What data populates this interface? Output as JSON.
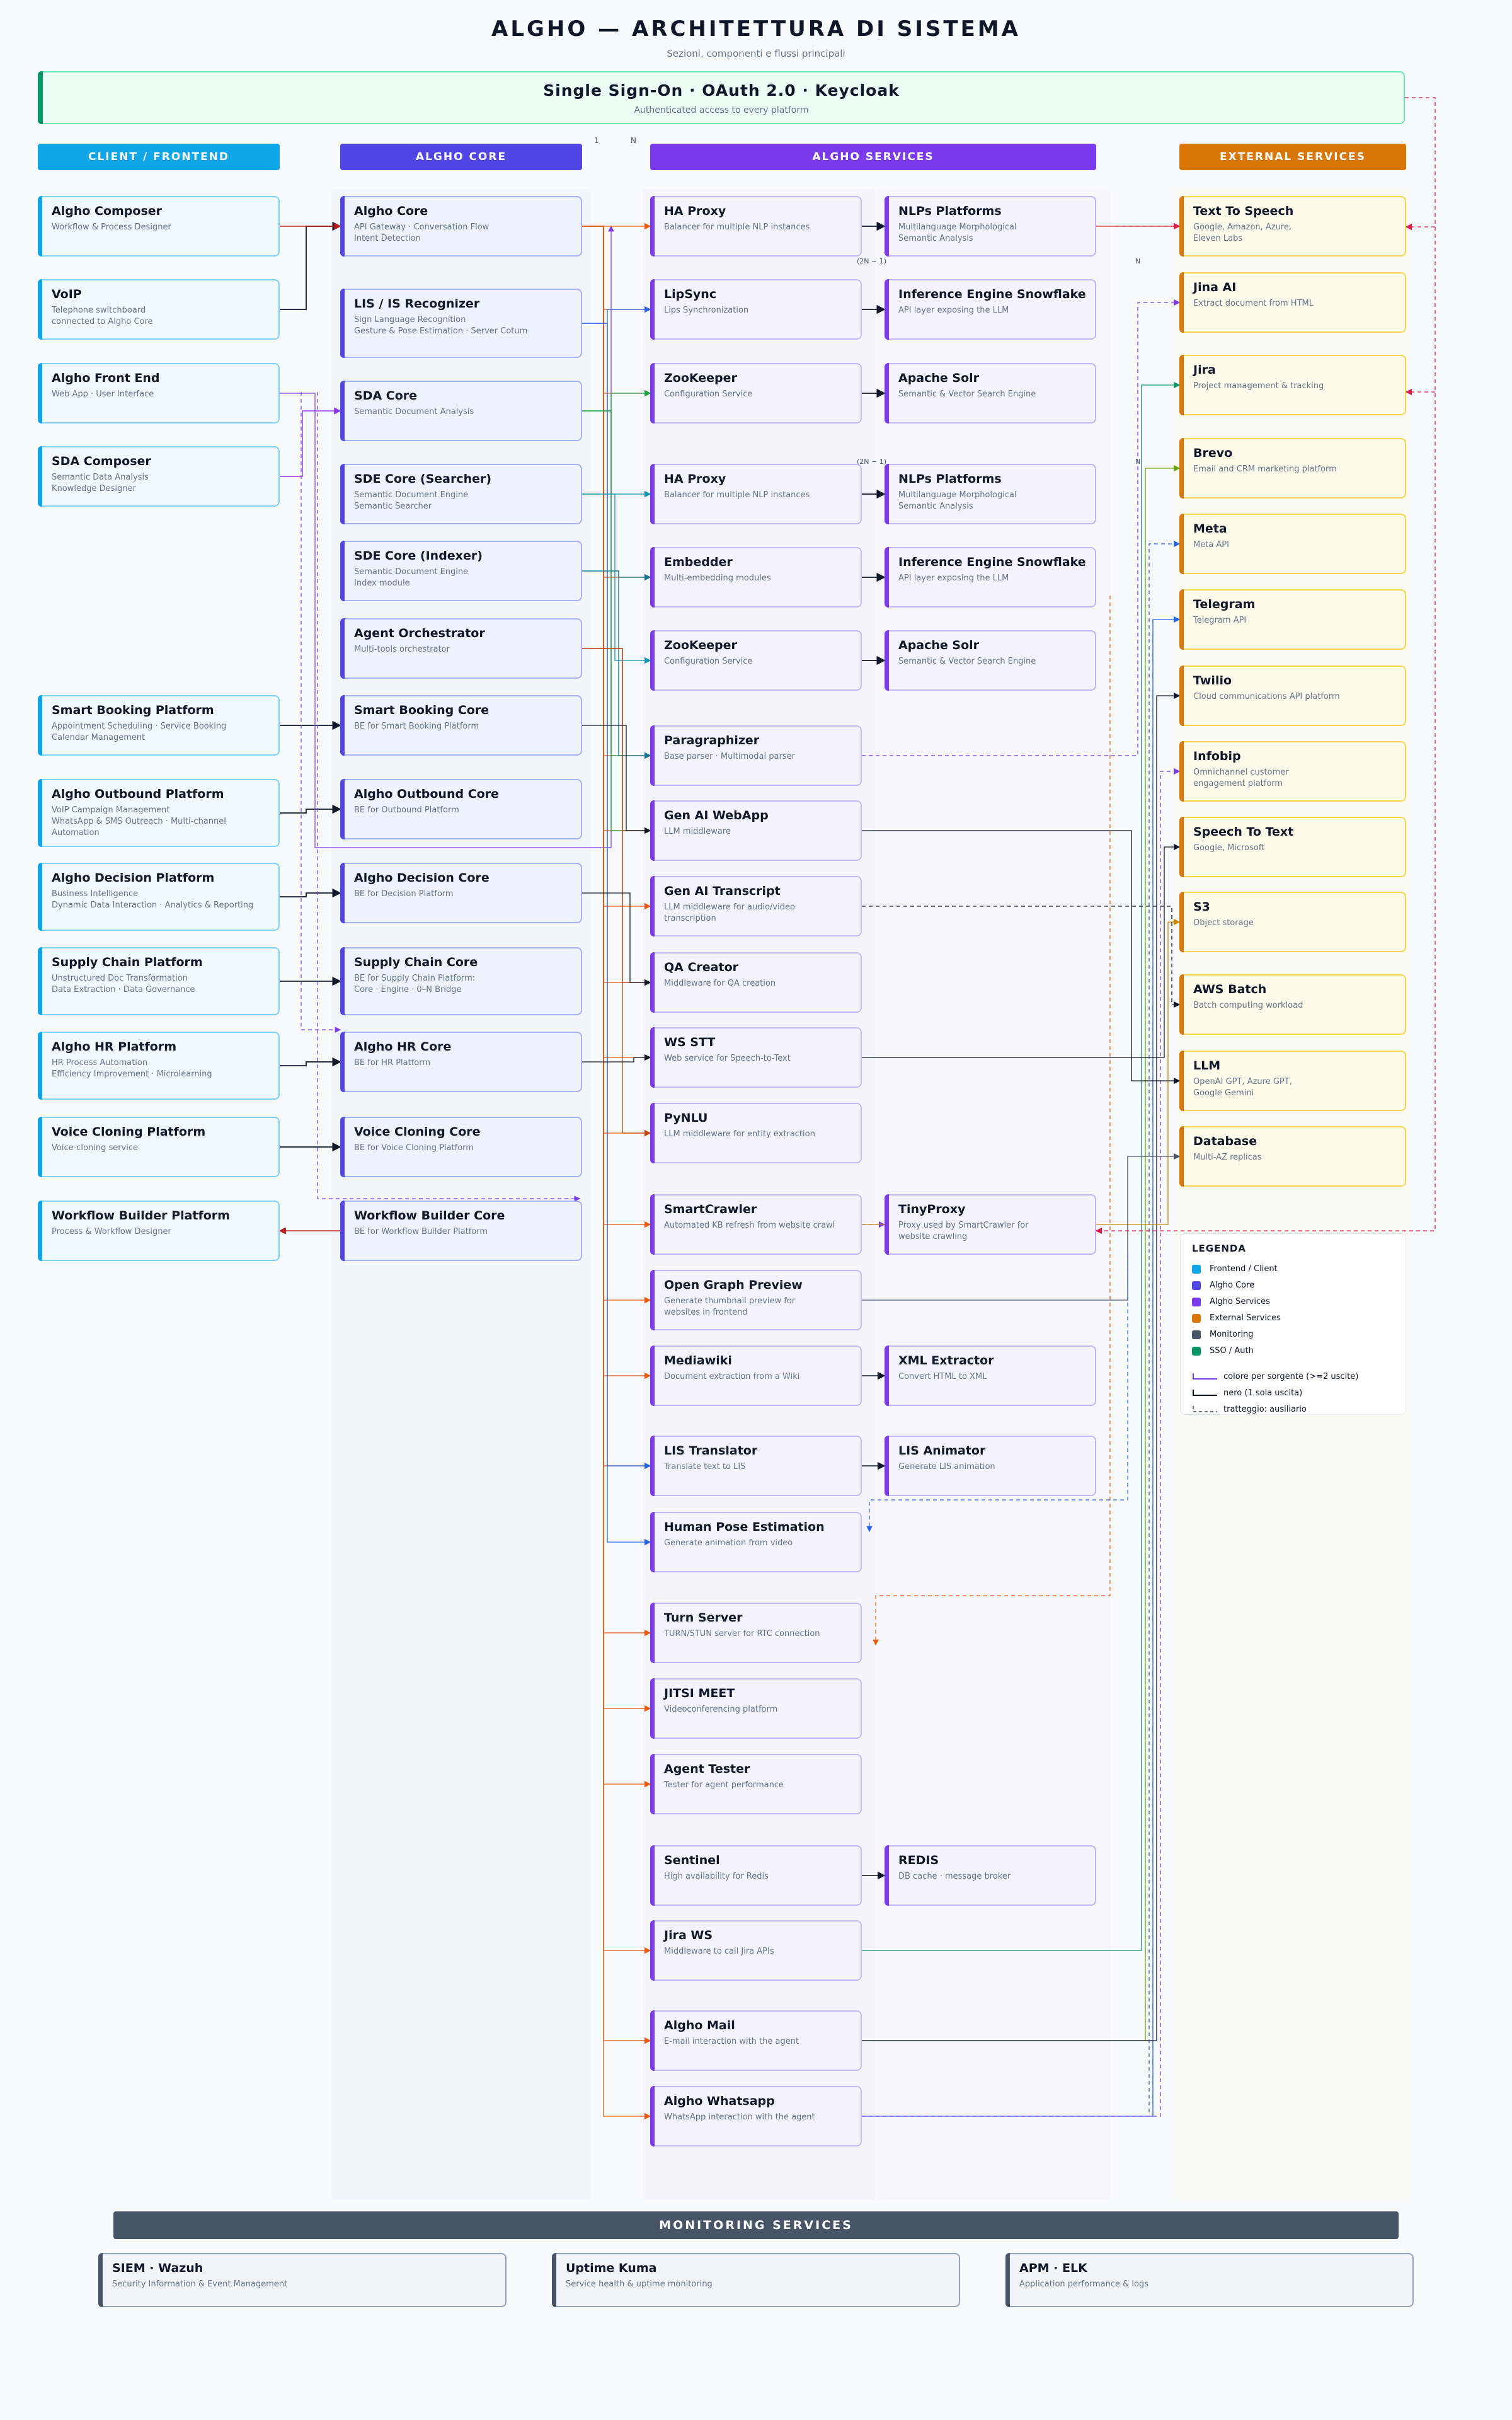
{
  "header": {
    "title": "ALGHO — ARCHITETTURA DI SISTEMA",
    "subtitle": "Sezioni, componenti e flussi principali"
  },
  "sso": {
    "title": "Single Sign-On · OAuth 2.0 · Keycloak",
    "subtitle": "Authenticated access to every platform"
  },
  "columns": {
    "client": "CLIENT / FRONTEND",
    "core": "ALGHO CORE",
    "services": "ALGHO SERVICES",
    "external": "EXTERNAL SERVICES"
  },
  "ratio_label": {
    "one": "1",
    "n": "N"
  },
  "replica_labels": [
    "(2N − 1)",
    "N",
    "(2N − 1)",
    "N"
  ],
  "colors": {
    "client": "#0ea5e9",
    "core": "#4f46e5",
    "services": "#7c3aed",
    "external": "#d97706",
    "monitoring": "#475569",
    "sso": "#059669"
  },
  "client_nodes": [
    {
      "title": "Algho Composer",
      "sub": "Workflow & Process Designer"
    },
    {
      "title": "VoIP",
      "sub": "Telephone switchboard\nconnected to Algho Core"
    },
    {
      "title": "Algho Front End",
      "sub": "Web App · User Interface"
    },
    {
      "title": "SDA Composer",
      "sub": "Semantic Data Analysis\nKnowledge Designer"
    },
    {
      "title": "Smart Booking Platform",
      "sub": "Appointment Scheduling · Service Booking\nCalendar Management"
    },
    {
      "title": "Algho Outbound Platform",
      "sub": "VoIP Campaign Management\nWhatsApp & SMS Outreach · Multi-channel Automation"
    },
    {
      "title": "Algho Decision Platform",
      "sub": "Business Intelligence\nDynamic Data Interaction · Analytics & Reporting"
    },
    {
      "title": "Supply Chain Platform",
      "sub": "Unstructured Doc Transformation\nData Extraction · Data Governance"
    },
    {
      "title": "Algho HR Platform",
      "sub": "HR Process Automation\nEfficiency Improvement · Microlearning"
    },
    {
      "title": "Voice Cloning Platform",
      "sub": "Voice-cloning service"
    },
    {
      "title": "Workflow Builder Platform",
      "sub": "Process & Workflow Designer"
    }
  ],
  "core_nodes": [
    {
      "title": "Algho Core",
      "sub": "API Gateway · Conversation Flow\nIntent Detection"
    },
    {
      "title": "LIS / IS Recognizer",
      "sub": "Sign Language Recognition\nGesture & Pose Estimation · Server Cotum"
    },
    {
      "title": "SDA Core",
      "sub": "Semantic Document Analysis"
    },
    {
      "title": "SDE Core (Searcher)",
      "sub": "Semantic Document Engine\nSemantic Searcher"
    },
    {
      "title": "SDE Core (Indexer)",
      "sub": "Semantic Document Engine\nIndex module"
    },
    {
      "title": "Agent Orchestrator",
      "sub": "Multi-tools orchestrator"
    },
    {
      "title": "Smart Booking Core",
      "sub": "BE for Smart Booking Platform"
    },
    {
      "title": "Algho Outbound Core",
      "sub": "BE for Outbound Platform"
    },
    {
      "title": "Algho Decision Core",
      "sub": "BE for Decision Platform"
    },
    {
      "title": "Supply Chain Core",
      "sub": "BE for Supply Chain Platform:\nCore · Engine · 0–N Bridge"
    },
    {
      "title": "Algho HR Core",
      "sub": "BE for HR Platform"
    },
    {
      "title": "Voice Cloning Core",
      "sub": "BE for Voice Cloning Platform"
    },
    {
      "title": "Workflow Builder Core",
      "sub": "BE for Workflow Builder Platform"
    }
  ],
  "service_nodes": [
    {
      "title": "HA Proxy",
      "sub": "Balancer for multiple NLP instances"
    },
    {
      "title": "LipSync",
      "sub": "Lips Synchronization"
    },
    {
      "title": "ZooKeeper",
      "sub": "Configuration Service"
    },
    {
      "title": "HA Proxy",
      "sub": "Balancer for multiple NLP instances"
    },
    {
      "title": "Embedder",
      "sub": "Multi-embedding modules"
    },
    {
      "title": "ZooKeeper",
      "sub": "Configuration Service"
    },
    {
      "title": "Paragraphizer",
      "sub": "Base parser · Multimodal parser"
    },
    {
      "title": "Gen AI WebApp",
      "sub": "LLM middleware"
    },
    {
      "title": "Gen AI Transcript",
      "sub": "LLM middleware for audio/video\ntranscription"
    },
    {
      "title": "QA Creator",
      "sub": "Middleware for QA creation"
    },
    {
      "title": "WS STT",
      "sub": "Web service for Speech-to-Text"
    },
    {
      "title": "PyNLU",
      "sub": "LLM middleware for entity extraction"
    },
    {
      "title": "SmartCrawler",
      "sub": "Automated KB refresh from website crawl"
    },
    {
      "title": "Open Graph Preview",
      "sub": "Generate thumbnail preview for\nwebsites in frontend"
    },
    {
      "title": "Mediawiki",
      "sub": "Document extraction from a Wiki"
    },
    {
      "title": "LIS Translator",
      "sub": "Translate text to LIS"
    },
    {
      "title": "Human Pose Estimation",
      "sub": "Generate animation from video"
    },
    {
      "title": "Turn Server",
      "sub": "TURN/STUN server for RTC connection"
    },
    {
      "title": "JITSI MEET",
      "sub": "Videoconferencing platform"
    },
    {
      "title": "Agent Tester",
      "sub": "Tester for agent performance"
    },
    {
      "title": "Sentinel",
      "sub": "High availability for Redis"
    },
    {
      "title": "Jira WS",
      "sub": "Middleware to call Jira APIs"
    },
    {
      "title": "Algho Mail",
      "sub": "E-mail interaction with the agent"
    },
    {
      "title": "Algho Whatsapp",
      "sub": "WhatsApp interaction with the agent"
    }
  ],
  "service_nodes_right": [
    {
      "title": "NLPs Platforms",
      "sub": "Multilanguage Morphological\nSemantic Analysis"
    },
    {
      "title": "Inference Engine Snowflake",
      "sub": "API layer exposing the LLM"
    },
    {
      "title": "Apache Solr",
      "sub": "Semantic & Vector Search Engine"
    },
    {
      "title": "NLPs Platforms",
      "sub": "Multilanguage Morphological\nSemantic Analysis"
    },
    {
      "title": "Inference Engine Snowflake",
      "sub": "API layer exposing the LLM"
    },
    {
      "title": "Apache Solr",
      "sub": "Semantic & Vector Search Engine"
    },
    {
      "title": "TinyProxy",
      "sub": "Proxy used by SmartCrawler for\nwebsite crawling"
    },
    {
      "title": "XML Extractor",
      "sub": "Convert HTML to XML"
    },
    {
      "title": "LIS Animator",
      "sub": "Generate LIS animation"
    },
    {
      "title": "REDIS",
      "sub": "DB cache · message broker"
    }
  ],
  "external_nodes": [
    {
      "title": "Text To Speech",
      "sub": "Google, Amazon, Azure,\nEleven Labs"
    },
    {
      "title": "Jina AI",
      "sub": "Extract document from HTML"
    },
    {
      "title": "Jira",
      "sub": "Project management & tracking"
    },
    {
      "title": "Brevo",
      "sub": "Email and CRM marketing platform"
    },
    {
      "title": "Meta",
      "sub": "Meta API"
    },
    {
      "title": "Telegram",
      "sub": "Telegram API"
    },
    {
      "title": "Twilio",
      "sub": "Cloud communications API platform"
    },
    {
      "title": "Infobip",
      "sub": "Omnichannel customer\nengagement platform"
    },
    {
      "title": "Speech To Text",
      "sub": "Google, Microsoft"
    },
    {
      "title": "S3",
      "sub": "Object storage"
    },
    {
      "title": "AWS Batch",
      "sub": "Batch computing workload"
    },
    {
      "title": "LLM",
      "sub": "OpenAI GPT, Azure GPT,\nGoogle Gemini"
    },
    {
      "title": "Database",
      "sub": "Multi-AZ replicas"
    }
  ],
  "legend": {
    "title": "LEGENDA",
    "items": [
      {
        "label": "Frontend / Client",
        "color": "#0ea5e9"
      },
      {
        "label": "Algho Core",
        "color": "#4f46e5"
      },
      {
        "label": "Algho Services",
        "color": "#7c3aed"
      },
      {
        "label": "External Services",
        "color": "#d97706"
      },
      {
        "label": "Monitoring",
        "color": "#475569"
      },
      {
        "label": "SSO / Auth",
        "color": "#059669"
      }
    ],
    "lines": [
      "colore per sorgente (>=2 uscite)",
      "nero (1 sola uscita)",
      "tratteggio: ausiliario"
    ]
  },
  "monitoring": {
    "title": "MONITORING SERVICES",
    "nodes": [
      {
        "title": "SIEM · Wazuh",
        "sub": "Security Information & Event Management"
      },
      {
        "title": "Uptime Kuma",
        "sub": "Service health & uptime monitoring"
      },
      {
        "title": "APM · ELK",
        "sub": "Application performance & logs"
      }
    ]
  }
}
